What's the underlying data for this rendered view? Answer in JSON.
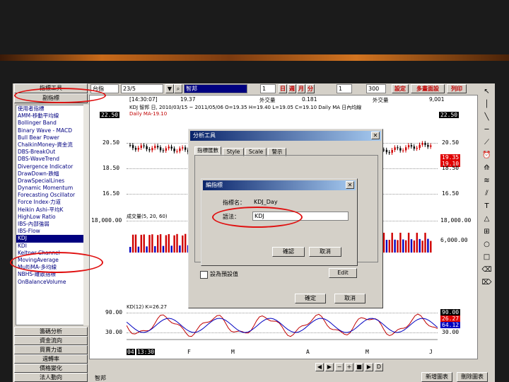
{
  "left_panel": {
    "top_label": "指標工具",
    "indicator_tab": "副指標",
    "list_items": [
      "使用者指標",
      "AMM-移動平均線",
      "Bollinger Band",
      "Binary Wave - MACD",
      "Bull Bear Power",
      "ChaikinMoney-資金流",
      "DBS-BreakOut",
      "DBS-WaveTrend",
      "Divergence Indicator",
      "DrawDown-跌幅",
      "DrawSpecialLines",
      "Dynamic Momentum",
      "Forecasting Oscillator",
      "Force Index-力道",
      "Heikin Ashi-平均K",
      "HighLow Ratio",
      "IBS-內部強弱",
      "IBS-Flow",
      "KDJ",
      "KDI",
      "Keltner Channel",
      "MovingAverage",
      "MultiMA-多均線",
      "NBHS-離散指標",
      "OnBalanceVolume"
    ],
    "selected_item": "KDJ",
    "buttons": [
      "籌碼分析",
      "資金流向",
      "買賣力道",
      "週轉率",
      "價格變化",
      "法人動向"
    ]
  },
  "toolbar": {
    "symbol": "台指",
    "date": "23/5",
    "search_text": "智邦",
    "num1": "1",
    "period_day": "日",
    "period_week": "週",
    "period_month": "月",
    "period_min": "分",
    "num2": "1",
    "count": "300",
    "btn_settings": "設定",
    "btn_multi": "多畫面設",
    "btn_print": "列印"
  },
  "chart": {
    "info_line": "KDJ  智邦 日, 2010/03/15 ~ 2011/05/06  O=19.35 H=19.40 L=19.05 C=19.10  Daily MA 日內均線",
    "ma_label": "Daily MA-19.10",
    "volume_label": "成交量(5, 20, 60)",
    "kd_label": "KD(12)  K=26.27",
    "y_price": [
      "22.50",
      "20.50",
      "18.50",
      "16.50"
    ],
    "y_volume": [
      "18,000.00"
    ],
    "y_kd": [
      "90.00",
      "30.00"
    ],
    "right_price": [
      "22.50",
      "20.50",
      "18.50",
      "16.50"
    ],
    "right_volume": [
      "18,000.00",
      "6,000.00"
    ],
    "right_kd": [
      "90.00",
      "30.00"
    ],
    "current_price": "19.35",
    "current_price2": "19.10",
    "kd_val1": "26.27",
    "kd_val2": "64.12",
    "x_labels": [
      "04",
      "13:30",
      "F",
      "M",
      "A",
      "M",
      "J"
    ],
    "header_cols": [
      "[14:30:07]",
      "19.37",
      "外交量",
      "0.181",
      "外交量",
      "9,001"
    ]
  },
  "dialog_analysis": {
    "title": "分析工具",
    "tabs": [
      "指標匯數",
      "Style",
      "Scale",
      "警示"
    ],
    "checkbox_label": "設為預設值",
    "btn_edit": "Edit",
    "btn_ok": "確定",
    "btn_cancel": "取消"
  },
  "dialog_kdj": {
    "title": "編指標",
    "name_label": "指標名：",
    "name_value": "KDJ_Day",
    "syntax_label": "語法：",
    "syntax_value": "KDJ",
    "btn_ok": "確認",
    "btn_cancel": "取消"
  },
  "bottom": {
    "symbol": "智邦",
    "btn_new": "新增圖表",
    "btn_delete": "刪除圖表"
  },
  "colors": {
    "accent_red": "#e01010",
    "title_blue": "#0a246a",
    "volume_red": "#d00000",
    "volume_blue": "#0000c0",
    "k_line": "#c00000",
    "d_line": "#0000c0"
  }
}
